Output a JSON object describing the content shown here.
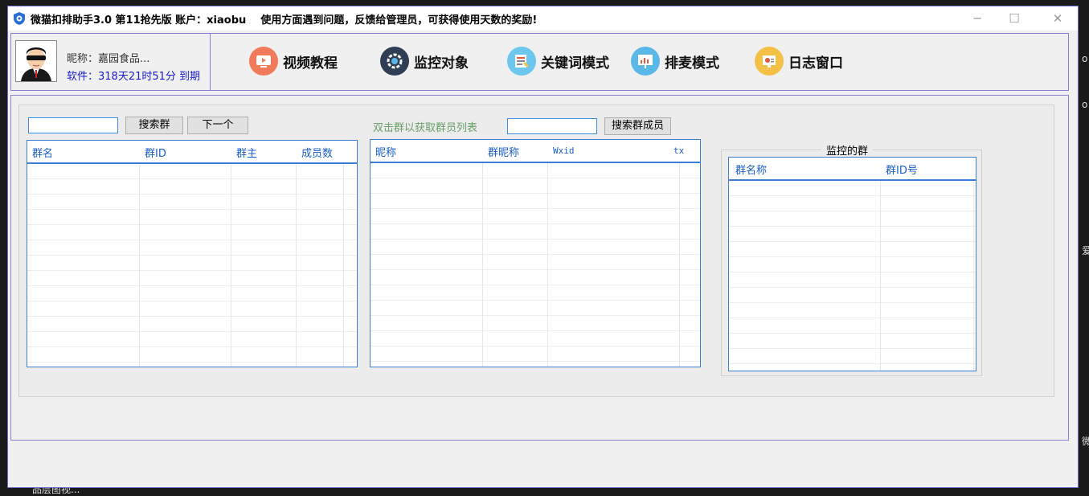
{
  "window": {
    "title": "微猫扣排助手3.0 第11抢先版 账户：xiaobu    使用方面遇到问题，反馈给管理员，可获得使用天数的奖励!",
    "controls": {
      "minimize": "─",
      "maximize": "☐",
      "close": "✕"
    }
  },
  "user": {
    "nickname": "昵称：嘉园食品...",
    "expiry": "软件：318天21时51分 到期"
  },
  "nav": [
    {
      "label": "视频教程",
      "icon": "video-icon",
      "color": "#f07a5a"
    },
    {
      "label": "监控对象",
      "icon": "gear-icon",
      "color": "#2f3e55"
    },
    {
      "label": "关键词模式",
      "icon": "keyword-icon",
      "color": "#6cc6ee"
    },
    {
      "label": "排麦模式",
      "icon": "chart-icon",
      "color": "#5ab8e6"
    },
    {
      "label": "日志窗口",
      "icon": "log-icon",
      "color": "#f5c046"
    }
  ],
  "group_search": {
    "value": "",
    "search_button": "搜索群",
    "next_button": "下一个"
  },
  "groups_table": {
    "columns": [
      "群名",
      "群ID",
      "群主",
      "成员数"
    ]
  },
  "members": {
    "hint": "双击群以获取群员列表",
    "value": "",
    "search_button": "搜索群成员",
    "columns": [
      "昵称",
      "群昵称",
      "Wxid",
      "tx"
    ]
  },
  "monitored": {
    "title": "监控的群",
    "columns": [
      "群名称",
      "群ID号"
    ]
  },
  "background_fragments": {
    "bottom_left": "品层图视...",
    "right_1": "o",
    "right_2": "o",
    "right_3": "爱",
    "right_4": "微"
  },
  "colors": {
    "accent_border": "#8a7fd4",
    "grid_border": "#3a7fd4",
    "header_text": "#1a5fc8",
    "expiry_text": "#1a1ad0",
    "hint_text": "#6aa06a"
  }
}
